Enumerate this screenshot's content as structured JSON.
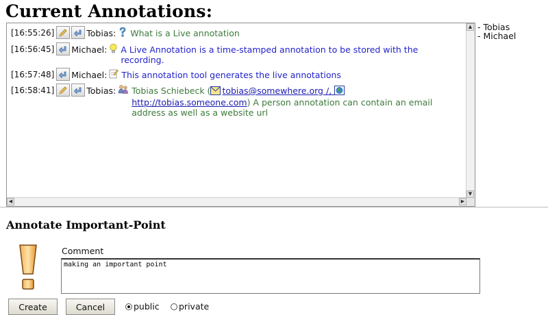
{
  "header": {
    "title": "Current Annotations:"
  },
  "entries": [
    {
      "time": "[16:55:26]",
      "author": "Tobias:",
      "icon": "question-icon",
      "text": "What is a Live annotation",
      "color": "#3d7a3a",
      "editable": true
    },
    {
      "time": "[16:56:45]",
      "author": "Michael:",
      "icon": "lightbulb-icon",
      "text": "A Live Annotation is a time-stamped annotation to be stored with the recording.",
      "color": "#2222cc",
      "editable": false
    },
    {
      "time": "[16:57:48]",
      "author": "Michael:",
      "icon": "note-icon",
      "text": "This annotation tool generates the live annotations",
      "color": "#2222cc",
      "editable": false
    },
    {
      "time": "[16:58:41]",
      "author": "Tobias:",
      "icon": "person-icon",
      "name": "Tobias Schiebeck",
      "open_paren": "(",
      "email": "tobias@somewhere.org",
      "sep": " /, ",
      "url": "http://tobias.someone.com",
      "close_text": ") A person annotation can contain an email address as well as a website url",
      "color": "#3d7a3a",
      "editable": true
    }
  ],
  "users": [
    "- Tobias",
    "- Michael"
  ],
  "annotate": {
    "title": "Annotate Important-Point",
    "comment_label": "Comment",
    "comment_value": "making an important point",
    "create_label": "Create",
    "cancel_label": "Cancel",
    "public_label": "public",
    "private_label": "private",
    "visibility": "public"
  }
}
